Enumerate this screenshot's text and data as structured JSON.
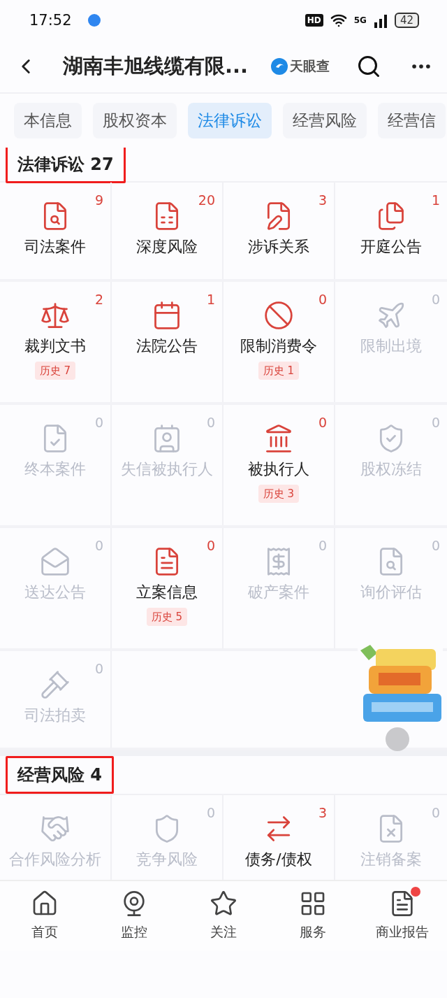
{
  "status_bar": {
    "time": "17:52",
    "hd": "HD",
    "network": "5G",
    "battery": "42"
  },
  "header": {
    "title": "湖南丰旭线缆有限...",
    "brand": "天眼查"
  },
  "tabs": [
    {
      "label": "本信息",
      "selected": false
    },
    {
      "label": "股权资本",
      "selected": false
    },
    {
      "label": "法律诉讼",
      "selected": true
    },
    {
      "label": "经营风险",
      "selected": false
    },
    {
      "label": "经营信",
      "selected": false
    }
  ],
  "sections": [
    {
      "title": "法律诉讼 27",
      "highlighted": true,
      "items": [
        {
          "label": "司法案件",
          "count": "9",
          "active": true
        },
        {
          "label": "深度风险",
          "count": "20",
          "active": true
        },
        {
          "label": "涉诉关系",
          "count": "3",
          "active": true
        },
        {
          "label": "开庭公告",
          "count": "1",
          "active": true
        },
        {
          "label": "裁判文书",
          "count": "2",
          "active": true,
          "history": "历史 7"
        },
        {
          "label": "法院公告",
          "count": "1",
          "active": true
        },
        {
          "label": "限制消费令",
          "count": "0",
          "active": true,
          "history": "历史 1"
        },
        {
          "label": "限制出境",
          "count": "0",
          "active": false
        },
        {
          "label": "终本案件",
          "count": "0",
          "active": false
        },
        {
          "label": "失信被执行人",
          "count": "0",
          "active": false
        },
        {
          "label": "被执行人",
          "count": "0",
          "active": true,
          "history": "历史 3"
        },
        {
          "label": "股权冻结",
          "count": "0",
          "active": false
        },
        {
          "label": "送达公告",
          "count": "0",
          "active": false
        },
        {
          "label": "立案信息",
          "count": "0",
          "active": true,
          "history": "历史 5"
        },
        {
          "label": "破产案件",
          "count": "0",
          "active": false
        },
        {
          "label": "询价评估",
          "count": "0",
          "active": false
        },
        {
          "label": "司法拍卖",
          "count": "0",
          "active": false
        }
      ]
    },
    {
      "title": "经营风险 4",
      "highlighted": true,
      "items": [
        {
          "label": "合作风险分析",
          "active": false
        },
        {
          "label": "竞争风险",
          "count": "0",
          "active": false
        },
        {
          "label": "债务/债权",
          "count": "3",
          "active": true
        },
        {
          "label": "注销备案",
          "count": "0",
          "active": false
        }
      ]
    }
  ],
  "bottom_nav": [
    {
      "label": "首页",
      "badge": false
    },
    {
      "label": "监控",
      "badge": false
    },
    {
      "label": "关注",
      "badge": false
    },
    {
      "label": "服务",
      "badge": false
    },
    {
      "label": "商业报告",
      "badge": true
    }
  ]
}
